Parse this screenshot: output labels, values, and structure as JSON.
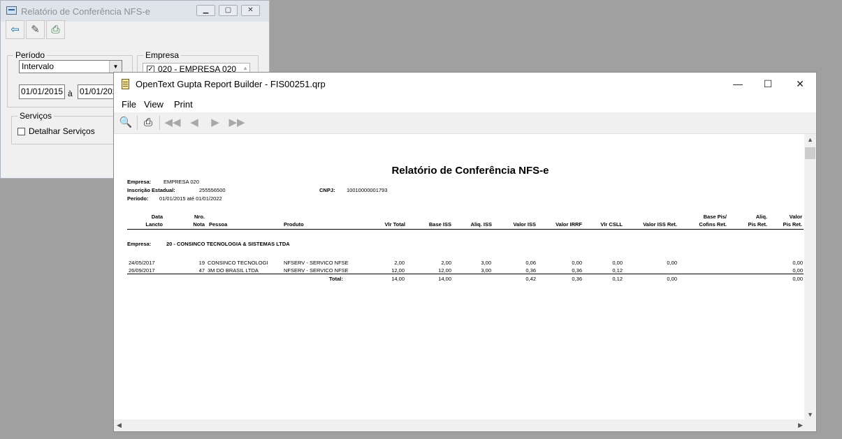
{
  "dialog": {
    "title": "Relatório de Conferência NFS-e",
    "periodo_legend": "Período",
    "periodo_value": "Intervalo",
    "date_from": "01/01/2015",
    "date_sep": "à",
    "date_to": "01/01/2022",
    "empresa_legend": "Empresa",
    "empresa_item": "020 - EMPRESA 020",
    "servicos_legend": "Serviços",
    "detalhar_label": "Detalhar Serviços"
  },
  "window": {
    "title": "OpenText Gupta Report Builder - FIS00251.qrp",
    "menu": [
      "File",
      "View",
      "Print"
    ]
  },
  "report": {
    "title": "Relatório de Conferência NFS-e",
    "empresa_label": "Empresa:",
    "empresa_value": "EMPRESA 020",
    "ie_label": "Inscrição Estadual:",
    "ie_value": "255556500",
    "cnpj_label": "CNPJ:",
    "cnpj_value": "10010000001793",
    "periodo_label": "Período:",
    "periodo_value": "01/01/2015 até 01/01/2022",
    "headers": {
      "data1": "Data",
      "data2": "Lancto",
      "nro1": "Nro.",
      "nro2": "Nota",
      "pessoa": "Pessoa",
      "produto": "Produto",
      "vlr_total": "Vlr Total",
      "base_iss": "Base ISS",
      "aliq_iss": "Aliq. ISS",
      "valor_iss": "Valor ISS",
      "valor_irrf": "Valor IRRF",
      "vlr_csll": "Vlr CSLL",
      "valor_iss_ret": "Valor ISS Ret.",
      "base_pis1": "Base Pis/",
      "base_pis2": "Cofins Ret.",
      "aliq_pis1": "Aliq.",
      "aliq_pis2": "Pis Ret.",
      "valor_pis1": "Valor",
      "valor_pis2": "Pis Ret."
    },
    "group_label": "Empresa:",
    "group_value": "20 - CONSINCO TECNOLOGIA & SISTEMAS LTDA",
    "rows": [
      {
        "data": "24/05/2017",
        "nota": "19",
        "pessoa": "CONSINCO TECNOLOGI",
        "produto": "NFSERV - SERVICO NFSE",
        "vlr_total": "2,00",
        "base_iss": "2,00",
        "aliq_iss": "3,00",
        "valor_iss": "0,06",
        "valor_irrf": "0,00",
        "vlr_csll": "0,00",
        "valor_iss_ret": "0,00",
        "valor_pis": "0,00"
      },
      {
        "data": "26/09/2017",
        "nota": "47",
        "pessoa": "3M DO BRASIL LTDA",
        "produto": "NFSERV - SERVICO NFSE",
        "vlr_total": "12,00",
        "base_iss": "12,00",
        "aliq_iss": "3,00",
        "valor_iss": "0,36",
        "valor_irrf": "0,36",
        "vlr_csll": "0,12",
        "valor_iss_ret": "",
        "valor_pis": "0,00"
      }
    ],
    "total": {
      "label": "Total:",
      "vlr_total": "14,00",
      "base_iss": "14,00",
      "valor_iss": "0,42",
      "valor_irrf": "0,36",
      "vlr_csll": "0,12",
      "valor_iss_ret": "0,00",
      "valor_pis": "0,00"
    }
  }
}
